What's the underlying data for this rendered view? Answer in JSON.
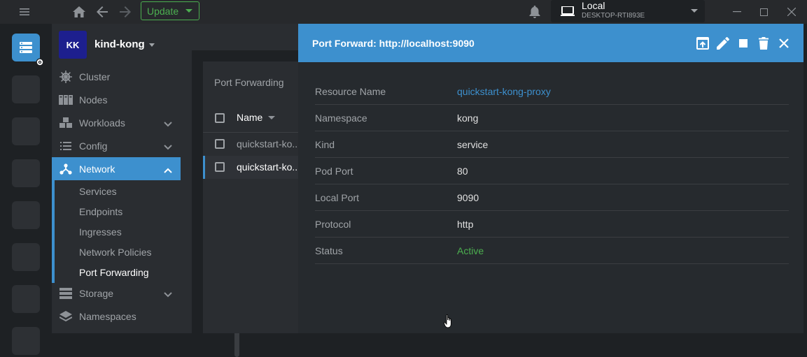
{
  "topbar": {
    "menu_icon": "hamburger-icon",
    "home_icon": "home-icon",
    "back_icon": "arrow-left-icon",
    "forward_icon": "arrow-right-icon",
    "update_label": "Update",
    "bell_icon": "bell-icon",
    "cluster_name": "Local",
    "cluster_host": "DESKTOP-RTI893E"
  },
  "sidebar": {
    "avatar": "KK",
    "cluster": "kind-kong",
    "items": [
      {
        "label": "Cluster",
        "icon": "helm-icon"
      },
      {
        "label": "Nodes",
        "icon": "nodes-icon"
      },
      {
        "label": "Workloads",
        "icon": "cubes-icon"
      },
      {
        "label": "Config",
        "icon": "list-icon"
      },
      {
        "label": "Network",
        "icon": "network-icon"
      },
      {
        "label": "Storage",
        "icon": "storage-icon"
      },
      {
        "label": "Namespaces",
        "icon": "layers-icon"
      }
    ],
    "network_sub": [
      "Services",
      "Endpoints",
      "Ingresses",
      "Network Policies",
      "Port Forwarding"
    ]
  },
  "list": {
    "title": "Port Forwarding",
    "column_name": "Name",
    "rows": [
      "quickstart-ko...",
      "quickstart-ko..."
    ]
  },
  "details": {
    "title": "Port Forward: http://localhost:9090",
    "rows": [
      {
        "key": "Resource Name",
        "value": "quickstart-kong-proxy"
      },
      {
        "key": "Namespace",
        "value": "kong"
      },
      {
        "key": "Kind",
        "value": "service"
      },
      {
        "key": "Pod Port",
        "value": "80"
      },
      {
        "key": "Local Port",
        "value": "9090"
      },
      {
        "key": "Protocol",
        "value": "http"
      },
      {
        "key": "Status",
        "value": "Active"
      }
    ]
  },
  "colors": {
    "accent": "#3d90ce",
    "success": "#4caf50",
    "avatar_bg": "#1d1f8e"
  }
}
